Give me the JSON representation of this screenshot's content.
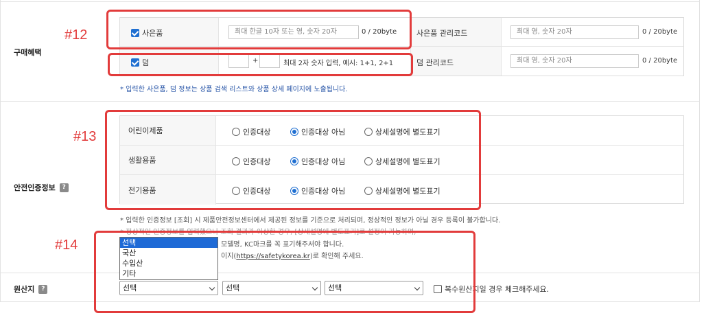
{
  "benefits": {
    "label": "구매혜택",
    "gift": {
      "checkbox_label": "사은품",
      "input_placeholder": "최대 한글 10자 또는 영, 숫자 20자",
      "counter": "0 / 20byte"
    },
    "gift_code": {
      "label": "사은품 관리코드",
      "input_placeholder": "최대 영, 숫자 20자",
      "counter": "0 / 20byte"
    },
    "bonus": {
      "checkbox_label": "덤",
      "plus": "+",
      "hint": "최대 2자 숫자 입력, 예시: 1+1, 2+1"
    },
    "bonus_code": {
      "label": "덤 관리코드",
      "input_placeholder": "최대 영, 숫자 20자",
      "counter": "0 / 20byte"
    },
    "note": "* 입력한 사은품, 덤 정보는 상품 검색 리스트와 상품 상세 페이지에 노출됩니다."
  },
  "safety": {
    "label": "안전인증정보",
    "options": [
      "인증대상",
      "인증대상 아님",
      "상세설명에 별도표기"
    ],
    "rows": [
      {
        "name": "어린이제품",
        "selected": 1
      },
      {
        "name": "생활용품",
        "selected": 1
      },
      {
        "name": "전기용품",
        "selected": 1
      }
    ],
    "note1": "* 입력한 인증정보 [조회] 시 제품안전정보센터에서 제공된 정보를 기준으로 처리되며, 정상적인 정보가 아닐 경우 등록이 불가합니다.",
    "note2": "* 정상적인 인증정보를 입력했으나 조회 결과가 이상한 경우, [상세설명에 별도표기]로 설정이 가능하며,",
    "note3": "모델명, KC마크를 꼭 표기해주셔야 합니다.",
    "note4_prefix": "이지(",
    "note4_link": "https://safetykorea.kr",
    "note4_suffix": ")로 확인해 주세요."
  },
  "origin": {
    "label": "원산지",
    "select1": "선택",
    "select2": "선택",
    "select3": "선택",
    "multi_checkbox": "복수원산지일 경우 체크해주세요.",
    "dropdown_options": [
      "선택",
      "국산",
      "수입산",
      "기타"
    ]
  },
  "annotations": {
    "a12": "#12",
    "a13": "#13",
    "a14": "#14",
    "color": "#e23b3b"
  }
}
